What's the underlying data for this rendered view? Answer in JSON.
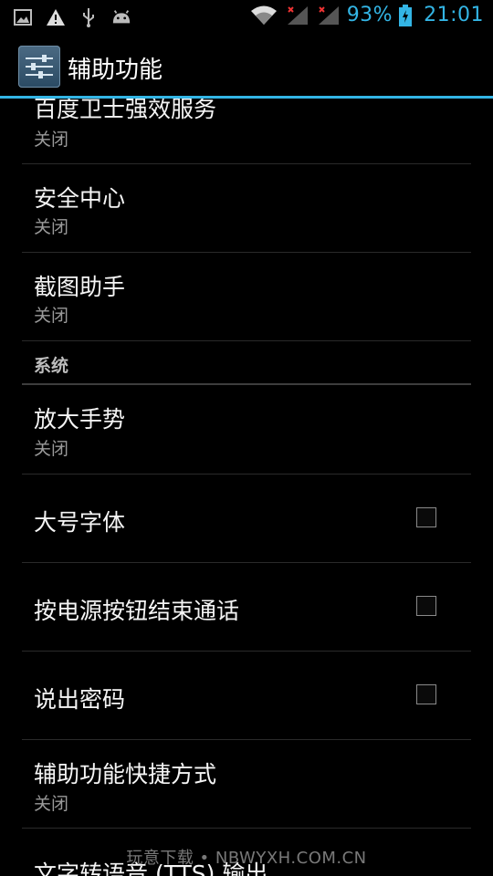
{
  "status_bar": {
    "battery_percent": "93%",
    "time": "21:01",
    "icons": [
      "image-icon",
      "warning-icon",
      "usb-icon",
      "android-icon",
      "wifi-icon",
      "signal-icon",
      "signal-icon",
      "battery-icon"
    ]
  },
  "action_bar": {
    "title": "辅助功能",
    "icon": "settings-sliders-icon"
  },
  "list": {
    "items": [
      {
        "title": "百度卫士强效服务",
        "summary": "关闭"
      },
      {
        "title": "安全中心",
        "summary": "关闭"
      },
      {
        "title": "截图助手",
        "summary": "关闭"
      }
    ],
    "section": "系统",
    "system_items": [
      {
        "title": "放大手势",
        "summary": "关闭"
      },
      {
        "title": "大号字体",
        "checked": false
      },
      {
        "title": "按电源按钮结束通话",
        "checked": false
      },
      {
        "title": "说出密码",
        "checked": false
      },
      {
        "title": "辅助功能快捷方式",
        "summary": "关闭"
      },
      {
        "title": "文字转语音 (TTS) 输出"
      }
    ]
  },
  "watermark": "玩意下载 • NBWYXH.COM.CN",
  "colors": {
    "accent": "#33b5e5",
    "background": "#000000"
  }
}
